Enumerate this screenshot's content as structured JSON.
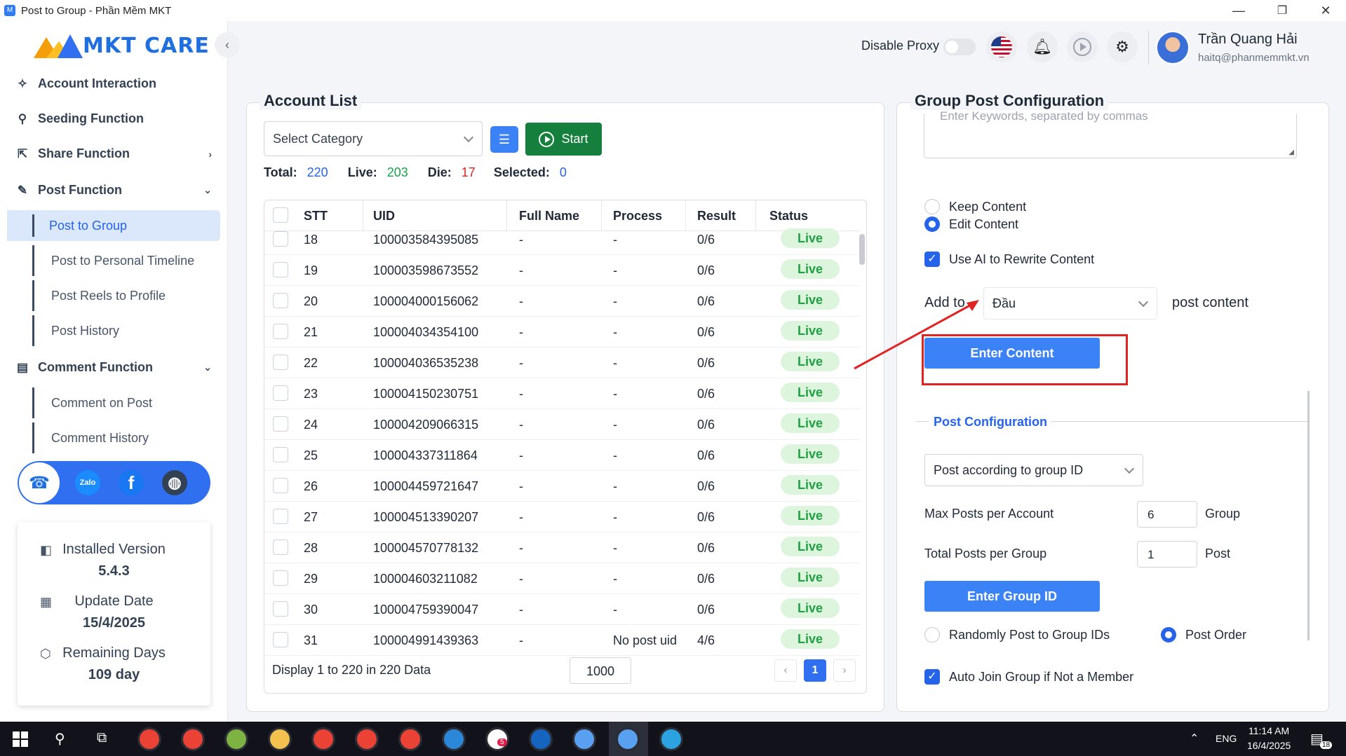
{
  "window": {
    "title": "Post to Group - Phần Mềm MKT",
    "controls": [
      "—",
      "❐",
      "✕"
    ]
  },
  "sidebar": {
    "logo_text": "MKT CARE",
    "collapse_icon": "chevron-left-icon",
    "items": [
      {
        "label": "Account Interaction",
        "icon": "sparkle-icon"
      },
      {
        "label": "Seeding Function",
        "icon": "seedling-icon"
      },
      {
        "label": "Share Function",
        "icon": "share-icon"
      },
      {
        "label": "Post Function",
        "icon": "edit-icon"
      },
      {
        "label": "Comment Function",
        "icon": "comment-icon"
      }
    ],
    "post_sub": [
      "Post to Group",
      "Post to Personal Timeline",
      "Post Reels to Profile",
      "Post History"
    ],
    "comment_sub": [
      "Comment on Post",
      "Comment History"
    ],
    "social": [
      "support-chat-icon",
      "zalo-icon",
      "facebook-icon",
      "globe-icon"
    ],
    "zalo_label": "Zalo",
    "info": {
      "installed_label": "Installed Version",
      "installed_value": "5.4.3",
      "update_label": "Update Date",
      "update_value": "15/4/2025",
      "remaining_label": "Remaining Days",
      "remaining_value": "109 day"
    }
  },
  "header": {
    "proxy_label": "Disable Proxy",
    "proxy_enabled": false,
    "user_name": "Trần Quang Hải",
    "user_email": "haitq@phanmemmkt.vn"
  },
  "account_list": {
    "title": "Account List",
    "category_placeholder": "Select Category",
    "start_label": "Start",
    "stats": {
      "total_label": "Total:",
      "total": "220",
      "live_label": "Live:",
      "live": "203",
      "die_label": "Die:",
      "die": "17",
      "selected_label": "Selected:",
      "selected": "0"
    },
    "columns": [
      "STT",
      "UID",
      "Full Name",
      "Process",
      "Result",
      "Status"
    ],
    "rows": [
      {
        "stt": "18",
        "uid": "100003584395085",
        "name": "-",
        "process": "-",
        "result": "0/6",
        "status": "Live"
      },
      {
        "stt": "19",
        "uid": "100003598673552",
        "name": "-",
        "process": "-",
        "result": "0/6",
        "status": "Live"
      },
      {
        "stt": "20",
        "uid": "100004000156062",
        "name": "-",
        "process": "-",
        "result": "0/6",
        "status": "Live"
      },
      {
        "stt": "21",
        "uid": "100004034354100",
        "name": "-",
        "process": "-",
        "result": "0/6",
        "status": "Live"
      },
      {
        "stt": "22",
        "uid": "100004036535238",
        "name": "-",
        "process": "-",
        "result": "0/6",
        "status": "Live"
      },
      {
        "stt": "23",
        "uid": "100004150230751",
        "name": "-",
        "process": "-",
        "result": "0/6",
        "status": "Live"
      },
      {
        "stt": "24",
        "uid": "100004209066315",
        "name": "-",
        "process": "-",
        "result": "0/6",
        "status": "Live"
      },
      {
        "stt": "25",
        "uid": "100004337311864",
        "name": "-",
        "process": "-",
        "result": "0/6",
        "status": "Live"
      },
      {
        "stt": "26",
        "uid": "100004459721647",
        "name": "-",
        "process": "-",
        "result": "0/6",
        "status": "Live"
      },
      {
        "stt": "27",
        "uid": "100004513390207",
        "name": "-",
        "process": "-",
        "result": "0/6",
        "status": "Live"
      },
      {
        "stt": "28",
        "uid": "100004570778132",
        "name": "-",
        "process": "-",
        "result": "0/6",
        "status": "Live"
      },
      {
        "stt": "29",
        "uid": "100004603211082",
        "name": "-",
        "process": "-",
        "result": "0/6",
        "status": "Live"
      },
      {
        "stt": "30",
        "uid": "100004759390047",
        "name": "-",
        "process": "-",
        "result": "0/6",
        "status": "Live"
      },
      {
        "stt": "31",
        "uid": "100004991439363",
        "name": "-",
        "process": "No post uid",
        "result": "4/6",
        "status": "Live"
      }
    ],
    "footer_text": "Display 1 to 220 in 220 Data",
    "page_size": "1000",
    "current_page": "1"
  },
  "config": {
    "title": "Group Post Configuration",
    "keywords_placeholder": "Enter Keywords, separated by commas",
    "keep_content": "Keep Content",
    "edit_content": "Edit Content",
    "content_mode": "edit",
    "use_ai": "Use AI to Rewrite Content",
    "use_ai_checked": true,
    "add_to_label": "Add to",
    "add_to_value": "Đầu",
    "post_content_label": "post content",
    "enter_content_button": "Enter Content",
    "post_config_title": "Post Configuration",
    "post_mode": "Post according to group ID",
    "max_posts_label": "Max Posts per Account",
    "max_posts_value": "6",
    "max_posts_unit": "Group",
    "total_posts_label": "Total Posts per Group",
    "total_posts_value": "1",
    "total_posts_unit": "Post",
    "enter_group_button": "Enter Group ID",
    "random_label": "Randomly Post to Group IDs",
    "order_label": "Post Order",
    "post_order_mode": "order",
    "auto_join_label": "Auto Join Group if Not a Member",
    "auto_join_checked": true
  },
  "taskbar": {
    "lang": "ENG",
    "time": "11:14 AM",
    "date": "16/4/2025",
    "notif_count": "18",
    "zalo_badge": "5",
    "apps": [
      "chrome-icon",
      "chrome-icon",
      "ccleaner-icon",
      "folder-icon",
      "chrome-icon",
      "chrome-icon",
      "chrome-icon",
      "remote-icon",
      "zalo-icon",
      "app-icon",
      "mkt-icon",
      "mkt-care-icon",
      "telegram-icon"
    ]
  },
  "colors": {
    "primary": "#2563eb",
    "live_bg": "#dcf5dc",
    "live_text": "#22a046",
    "start_green": "#15803d",
    "annotation_red": "#e02424"
  }
}
